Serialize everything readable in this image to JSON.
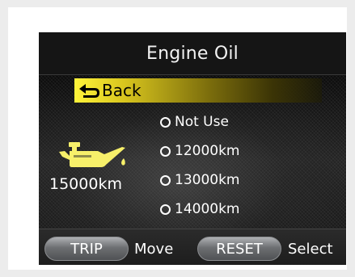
{
  "screen": {
    "title": "Engine Oil",
    "back_label": "Back",
    "current_interval": "15000km",
    "options": [
      {
        "label": "Not Use"
      },
      {
        "label": "12000km"
      },
      {
        "label": "13000km"
      },
      {
        "label": "14000km"
      }
    ],
    "controls": {
      "trip_label": "TRIP",
      "move_label": "Move",
      "reset_label": "RESET",
      "select_label": "Select"
    }
  },
  "icons": {
    "back": "return-arrow-icon",
    "oil": "oil-can-icon",
    "radio": "radio-unselected-icon"
  },
  "colors": {
    "highlight": "#fff43a",
    "oil_icon": "#f7f06a",
    "text": "#ffffff",
    "screen_bg": "#0c0c0c"
  }
}
